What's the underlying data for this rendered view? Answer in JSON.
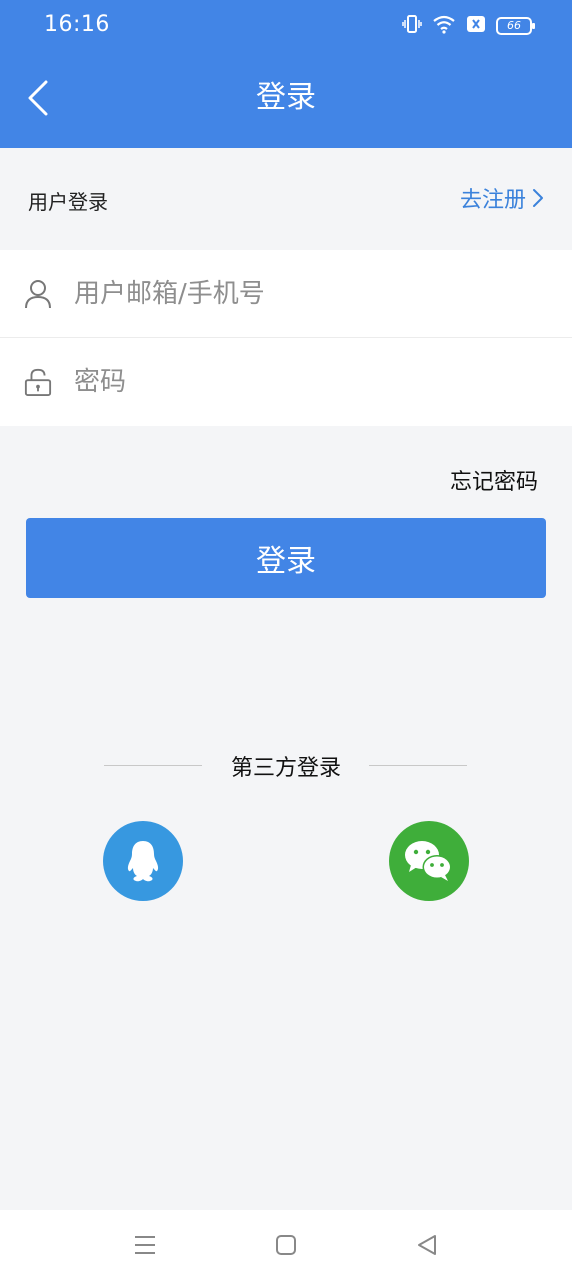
{
  "status_bar": {
    "time": "16:16",
    "battery": "66"
  },
  "header": {
    "title": "登录"
  },
  "section": {
    "title": "用户登录",
    "register_link": "去注册"
  },
  "form": {
    "account_placeholder": "用户邮箱/手机号",
    "password_placeholder": "密码"
  },
  "forgot_password": "忘记密码",
  "login_button": "登录",
  "third_party": {
    "label": "第三方登录",
    "providers": [
      "qq-icon",
      "wechat-icon"
    ]
  },
  "colors": {
    "primary": "#4285e6",
    "qq": "#3798e0",
    "wechat": "#3fae3a",
    "link": "#3b82db"
  }
}
